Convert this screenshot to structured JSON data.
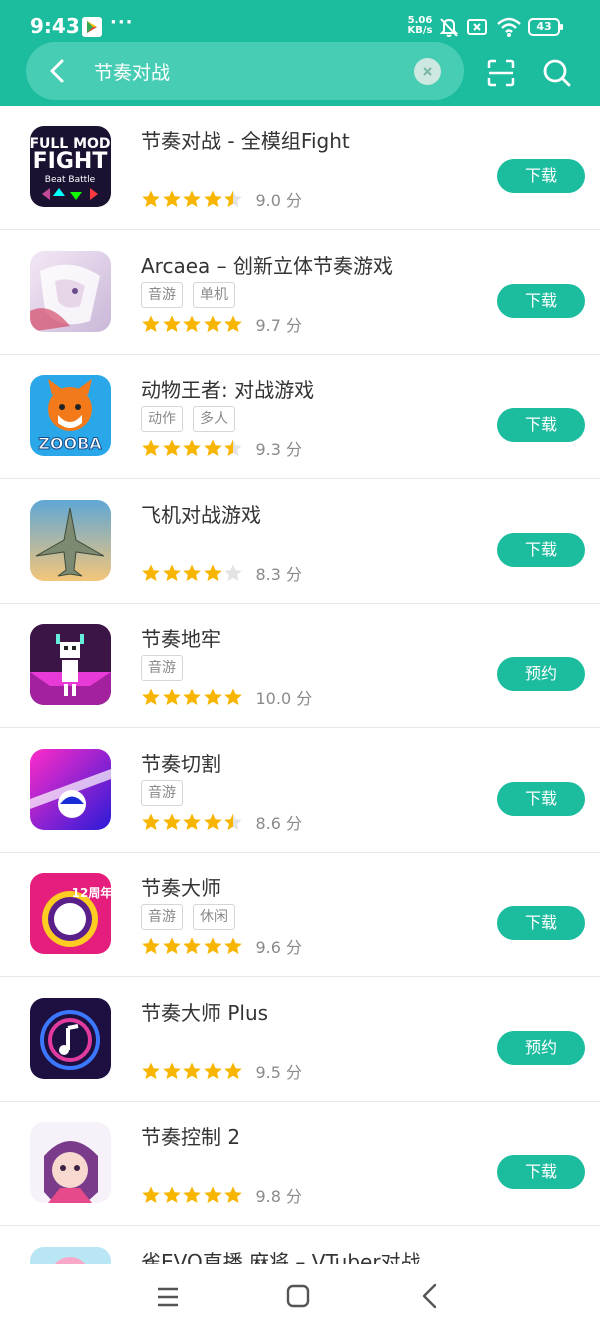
{
  "status_bar": {
    "time": "9:43",
    "dots": "···",
    "net_speed_value": "5.06",
    "net_speed_unit": "KB/s",
    "battery": "43"
  },
  "search": {
    "query": "节奏对战"
  },
  "accent_color": "#1cbc9f",
  "star_color": "#f7b500",
  "apps": [
    {
      "name": "节奏对战 - 全模组Fight",
      "tags": [],
      "rating": 4.5,
      "score": "9.0 分",
      "action": "下载",
      "icon": "fnf-icon"
    },
    {
      "name": "Arcaea – 创新立体节奏游戏",
      "tags": [
        "音游",
        "单机"
      ],
      "rating": 5,
      "score": "9.7 分",
      "action": "下载",
      "icon": "arcaea-icon"
    },
    {
      "name": "动物王者: 对战游戏",
      "tags": [
        "动作",
        "多人"
      ],
      "rating": 4.5,
      "score": "9.3 分",
      "action": "下载",
      "icon": "zooba-icon"
    },
    {
      "name": "飞机对战游戏",
      "tags": [],
      "rating": 4,
      "score": "8.3 分",
      "action": "下载",
      "icon": "jet-icon"
    },
    {
      "name": "节奏地牢",
      "tags": [
        "音游"
      ],
      "rating": 5,
      "score": "10.0 分",
      "action": "预约",
      "icon": "dungeon-icon"
    },
    {
      "name": "节奏切割",
      "tags": [
        "音游"
      ],
      "rating": 4.5,
      "score": "8.6 分",
      "action": "下载",
      "icon": "cut-icon"
    },
    {
      "name": "节奏大师",
      "tags": [
        "音游",
        "休闲"
      ],
      "rating": 5,
      "score": "9.6 分",
      "action": "下载",
      "icon": "master-icon"
    },
    {
      "name": "节奏大师 Plus",
      "tags": [],
      "rating": 5,
      "score": "9.5 分",
      "action": "预约",
      "icon": "master-plus-icon"
    },
    {
      "name": "节奏控制 2",
      "tags": [],
      "rating": 5,
      "score": "9.8 分",
      "action": "下载",
      "icon": "control-icon"
    },
    {
      "name": "雀EVO直播 麻将 – VTuber对战",
      "tags": [],
      "rating": 0,
      "score": "",
      "action": "",
      "icon": "mahjong-icon"
    }
  ]
}
